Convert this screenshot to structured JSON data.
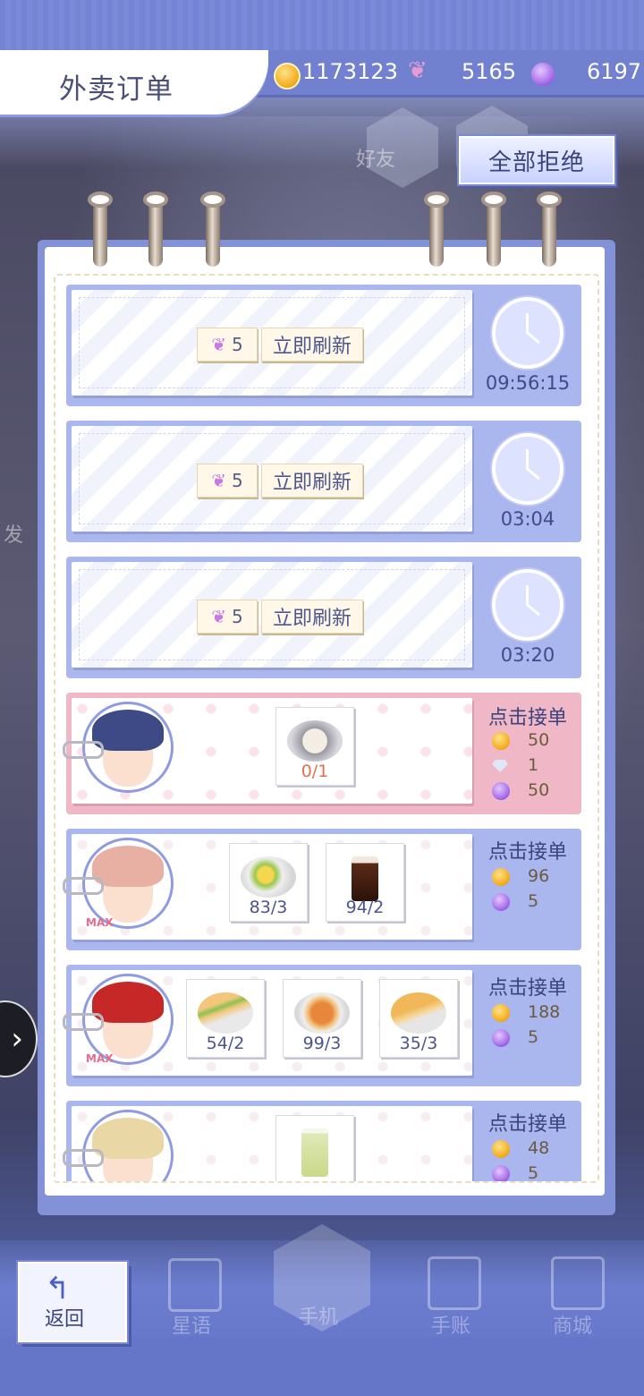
{
  "header": {
    "title": "外卖订单",
    "currencies": [
      {
        "icon": "gold-coin-icon",
        "value": "1173123"
      },
      {
        "icon": "swan-crystal-icon",
        "value": "5165"
      },
      {
        "icon": "purple-gem-icon",
        "value": "6197"
      }
    ],
    "reject_all": "全部拒绝"
  },
  "background_labels": {
    "friends": "好友",
    "fa": "发"
  },
  "refresh_slots": [
    {
      "cost": "5",
      "label": "立即刷新",
      "timer": "09:56:15"
    },
    {
      "cost": "5",
      "label": "立即刷新",
      "timer": "03:04"
    },
    {
      "cost": "5",
      "label": "立即刷新",
      "timer": "03:20"
    }
  ],
  "orders": [
    {
      "accept": "点击接单",
      "max": "",
      "items": [
        {
          "name": "latte-art-coffee",
          "count": "0/1"
        }
      ],
      "rewards": [
        {
          "icon": "coin",
          "value": "50"
        },
        {
          "icon": "diamond",
          "value": "1"
        },
        {
          "icon": "gem",
          "value": "50"
        }
      ]
    },
    {
      "accept": "点击接单",
      "max": "MAX",
      "items": [
        {
          "name": "egg-salad",
          "count": "83/3"
        },
        {
          "name": "iced-cola",
          "count": "94/2"
        }
      ],
      "rewards": [
        {
          "icon": "coin",
          "value": "96"
        },
        {
          "icon": "gem",
          "value": "5"
        }
      ]
    },
    {
      "accept": "点击接单",
      "max": "MAX",
      "items": [
        {
          "name": "sandwich",
          "count": "54/2"
        },
        {
          "name": "pasta",
          "count": "99/3"
        },
        {
          "name": "pizza-slice",
          "count": "35/3"
        }
      ],
      "rewards": [
        {
          "icon": "coin",
          "value": "188"
        },
        {
          "icon": "gem",
          "value": "5"
        }
      ]
    },
    {
      "accept": "点击接单",
      "max": "",
      "items": [
        {
          "name": "lemon-drink",
          "count": ""
        }
      ],
      "rewards": [
        {
          "icon": "coin",
          "value": "48"
        },
        {
          "icon": "gem",
          "value": "5"
        }
      ]
    }
  ],
  "nav": {
    "back": "返回",
    "items": [
      "星语",
      "手机",
      "手账",
      "商城"
    ]
  },
  "colors": {
    "accent": "#7281cf",
    "text": "#3b437d",
    "pink_card": "#f0b7c6",
    "blue_card": "#aab6ee"
  }
}
